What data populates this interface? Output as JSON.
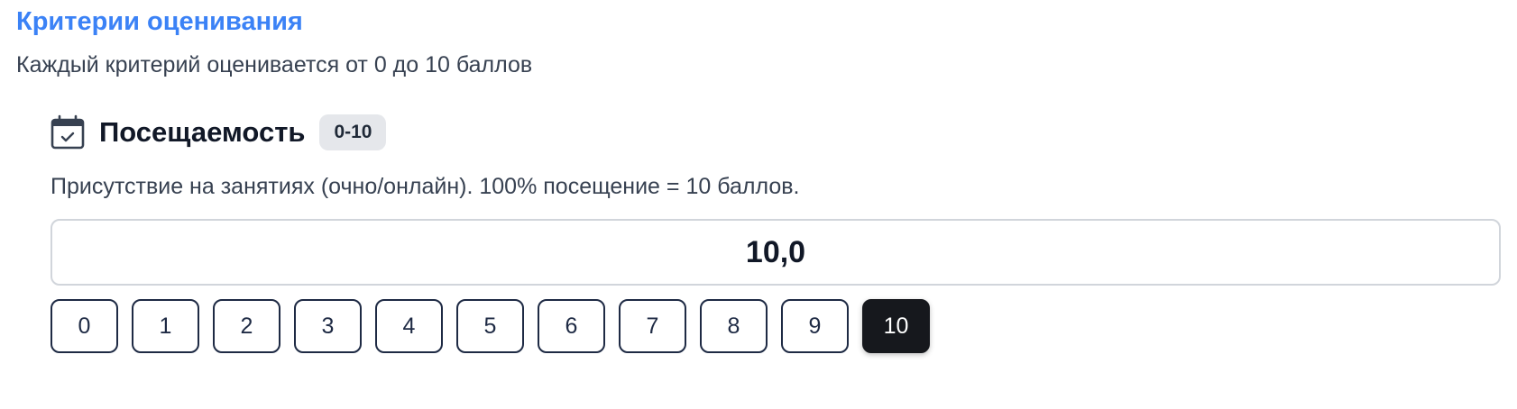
{
  "section": {
    "title": "Критерии оценивания",
    "subtitle": "Каждый критерий оценивается от 0 до 10 баллов"
  },
  "criterion": {
    "icon": "calendar-check-icon",
    "name": "Посещаемость",
    "range_badge": "0-10",
    "description": "Присутствие на занятиях (очно/онлайн). 100% посещение = 10 баллов.",
    "score_value": "10,0",
    "score_options": [
      "0",
      "1",
      "2",
      "3",
      "4",
      "5",
      "6",
      "7",
      "8",
      "9",
      "10"
    ],
    "selected_option": "10"
  },
  "colors": {
    "accent": "#3b82f6",
    "selected_button": "#16181d",
    "button_border": "#1e2a44",
    "badge_bg": "#e5e7eb"
  }
}
